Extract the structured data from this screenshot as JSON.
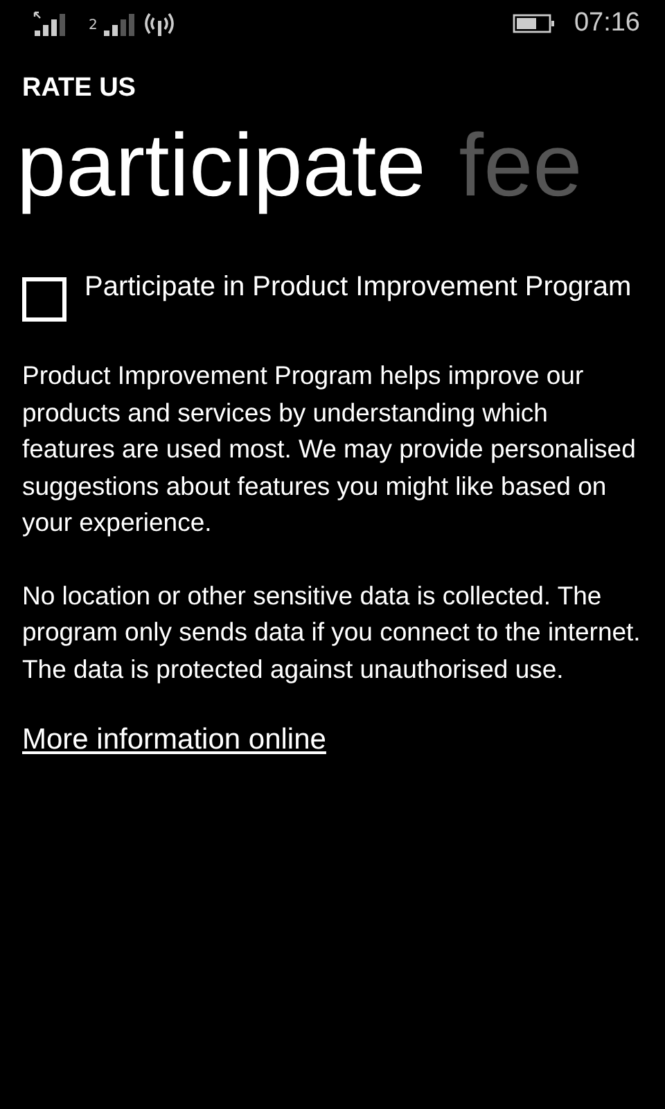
{
  "status_bar": {
    "sim_number": "2",
    "time": "07:16"
  },
  "app_title": "RATE US",
  "pivots": [
    {
      "label": "participate",
      "selected": true
    },
    {
      "label": "fee",
      "selected": false
    }
  ],
  "checkbox": {
    "label": "Participate in Product Improvement Program",
    "checked": false
  },
  "paragraphs": [
    "Product Improvement Program helps improve our products and services by understanding which features are used most. We may provide personalised suggestions about features you might like based on your experience.",
    "No location or other sensitive data is collected. The program only sends data if you connect to the internet. The data is protected against unauthorised use."
  ],
  "link": "More information online"
}
